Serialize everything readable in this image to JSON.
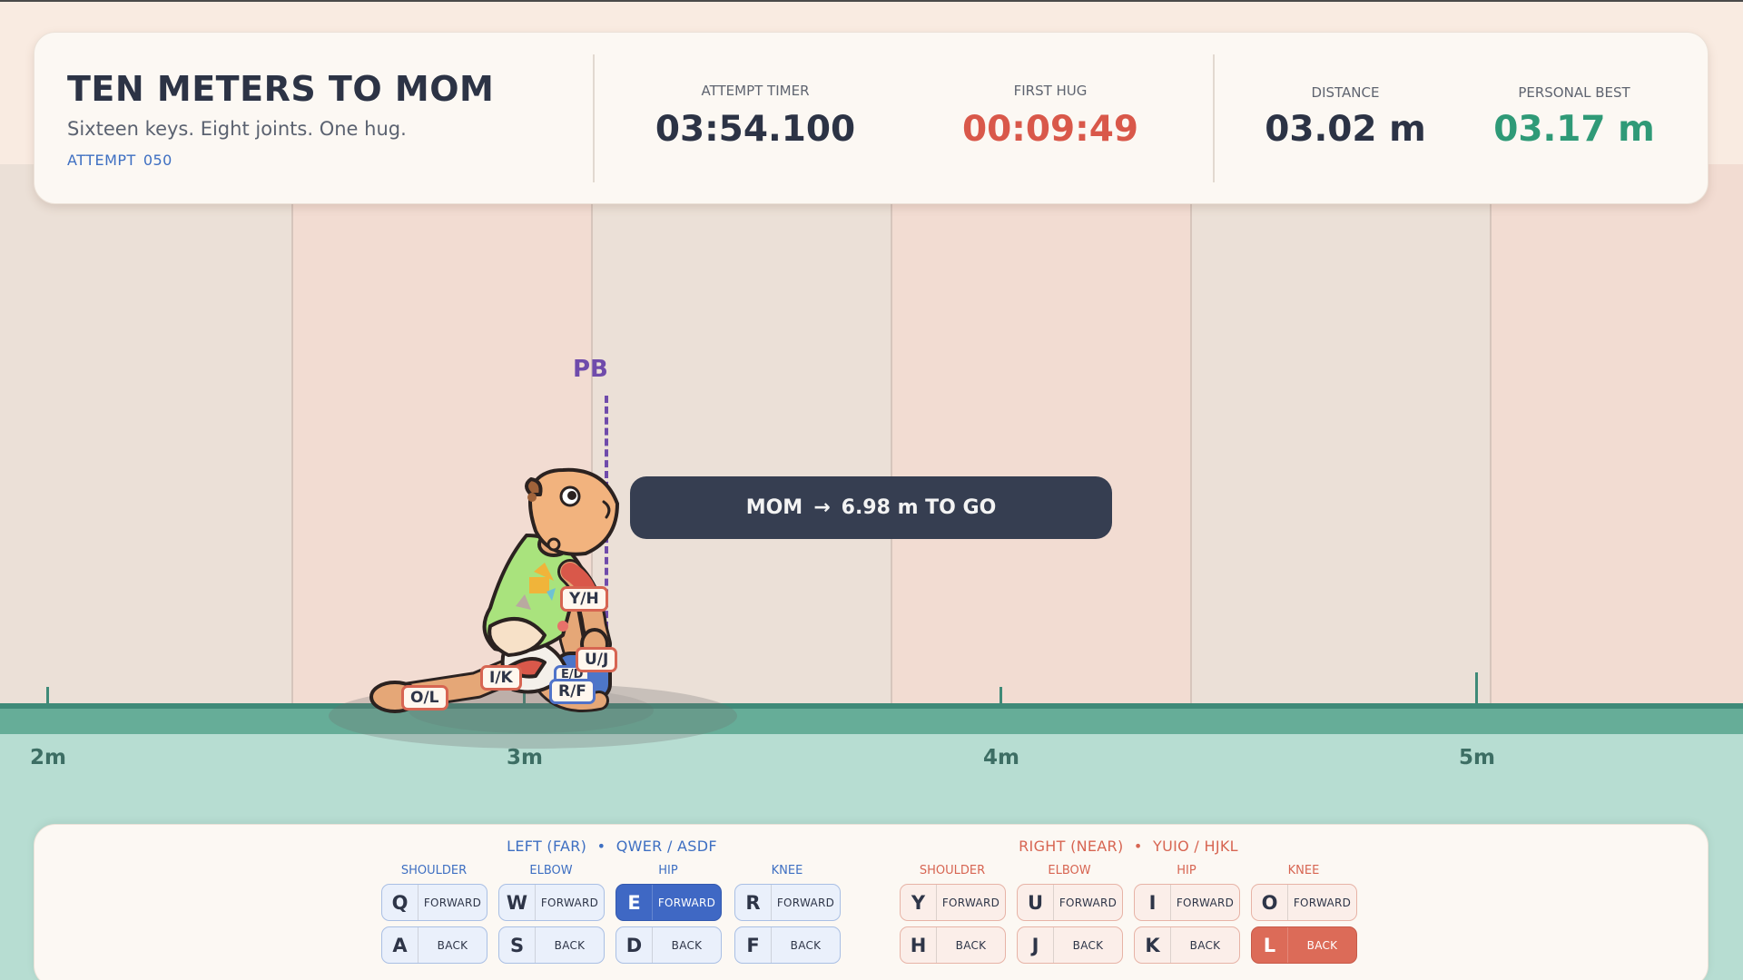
{
  "game": {
    "title": "TEN METERS TO MOM",
    "subtitle": "Sixteen keys. Eight joints. One hug.",
    "attempt_label": "ATTEMPT",
    "attempt_number": "050"
  },
  "stats": {
    "attempt_timer": {
      "label": "ATTEMPT TIMER",
      "value": "03:54.100",
      "color": "#2c3345"
    },
    "first_hug": {
      "label": "FIRST HUG",
      "value": "00:09:49",
      "color": "#d9584a"
    },
    "distance": {
      "label": "DISTANCE",
      "value": "03.02 m",
      "color": "#2c3345"
    },
    "personal_best": {
      "label": "PERSONAL BEST",
      "value": "03.17 m",
      "color": "#2f9a77"
    }
  },
  "track": {
    "meter_labels": [
      "2m",
      "3m",
      "4m",
      "5m"
    ],
    "pb_marker": "PB"
  },
  "banner": {
    "target": "MOM",
    "arrow": "→",
    "remaining": "6.98 m TO GO"
  },
  "joint_tags": {
    "right_shoulder": "Y/H",
    "right_elbow": "U/J",
    "right_hip": "I/K",
    "right_knee": "O/L",
    "left_knee": "R/F",
    "left_hip": "E/D"
  },
  "controls": {
    "left": {
      "title": "LEFT (FAR)",
      "keys_hint": "QWER / ASDF",
      "columns": [
        {
          "label": "SHOULDER",
          "fwd_key": "Q",
          "back_key": "A"
        },
        {
          "label": "ELBOW",
          "fwd_key": "W",
          "back_key": "S"
        },
        {
          "label": "HIP",
          "fwd_key": "E",
          "back_key": "D"
        },
        {
          "label": "KNEE",
          "fwd_key": "R",
          "back_key": "F"
        }
      ]
    },
    "right": {
      "title": "RIGHT (NEAR)",
      "keys_hint": "YUIO / HJKL",
      "columns": [
        {
          "label": "SHOULDER",
          "fwd_key": "Y",
          "back_key": "H"
        },
        {
          "label": "ELBOW",
          "fwd_key": "U",
          "back_key": "J"
        },
        {
          "label": "HIP",
          "fwd_key": "I",
          "back_key": "K"
        },
        {
          "label": "KNEE",
          "fwd_key": "O",
          "back_key": "L"
        }
      ]
    },
    "separator": "•",
    "forward_label": "FORWARD",
    "back_label": "BACK",
    "pressed_keys": [
      "E",
      "L"
    ]
  }
}
